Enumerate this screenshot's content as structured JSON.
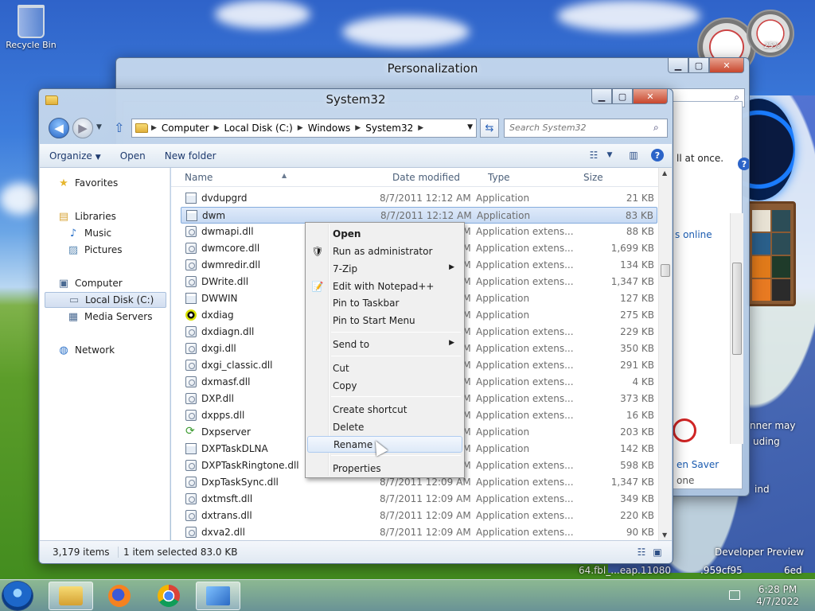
{
  "desktop": {
    "recycle_bin_label": "Recycle Bin",
    "bg_fragments": [
      "nner may",
      "uding",
      "en Saver",
      "one",
      "ind",
      "Developer Preview",
      "64.fbl_...eap.11080",
      ".959cf95",
      "6ed"
    ],
    "gadget_cpu_label": "25%"
  },
  "personalization": {
    "title": "Personalization",
    "text_all_at_once": "ll at once.",
    "text_online": "s online",
    "screen_saver_label": "en Saver",
    "screen_saver_value": "one"
  },
  "explorer": {
    "title": "System32",
    "breadcrumbs": [
      "Computer",
      "Local Disk (C:)",
      "Windows",
      "System32"
    ],
    "search_placeholder": "Search System32",
    "commands": {
      "organize": "Organize",
      "open": "Open",
      "new_folder": "New folder"
    },
    "nav": {
      "favorites": "Favorites",
      "libraries": "Libraries",
      "music": "Music",
      "pictures": "Pictures",
      "computer": "Computer",
      "local_disk": "Local Disk (C:)",
      "media_servers": "Media Servers",
      "network": "Network"
    },
    "columns": {
      "name": "Name",
      "date_modified": "Date modified",
      "type": "Type",
      "size": "Size"
    },
    "files": [
      {
        "name": "dvdupgrd",
        "date": "8/7/2011 12:12 AM",
        "type": "Application",
        "size": "21 KB",
        "icon": "app"
      },
      {
        "name": "dwm",
        "date": "8/7/2011 12:12 AM",
        "type": "Application",
        "size": "83 KB",
        "icon": "app"
      },
      {
        "name": "dwmapi.dll",
        "date": "8/7/2011 12:12 AM",
        "type": "Application extens...",
        "size": "88 KB",
        "icon": "dll"
      },
      {
        "name": "dwmcore.dll",
        "date": "8/7/2011 12:12 AM",
        "type": "Application extens...",
        "size": "1,699 KB",
        "icon": "dll"
      },
      {
        "name": "dwmredir.dll",
        "date": "8/7/2011 12:12 AM",
        "type": "Application extens...",
        "size": "134 KB",
        "icon": "dll"
      },
      {
        "name": "DWrite.dll",
        "date": "8/7/2011 12:12 AM",
        "type": "Application extens...",
        "size": "1,347 KB",
        "icon": "dll"
      },
      {
        "name": "DWWIN",
        "date": "8/7/2011 12:12 AM",
        "type": "Application",
        "size": "127 KB",
        "icon": "app"
      },
      {
        "name": "dxdiag",
        "date": "8/7/2011 12:12 AM",
        "type": "Application",
        "size": "275 KB",
        "icon": "xbox"
      },
      {
        "name": "dxdiagn.dll",
        "date": "8/7/2011 12:12 AM",
        "type": "Application extens...",
        "size": "229 KB",
        "icon": "dll"
      },
      {
        "name": "dxgi.dll",
        "date": "8/7/2011 12:12 AM",
        "type": "Application extens...",
        "size": "350 KB",
        "icon": "dll"
      },
      {
        "name": "dxgi_classic.dll",
        "date": "8/7/2011 12:12 AM",
        "type": "Application extens...",
        "size": "291 KB",
        "icon": "dll"
      },
      {
        "name": "dxmasf.dll",
        "date": "8/7/2011 12:12 AM",
        "type": "Application extens...",
        "size": "4 KB",
        "icon": "dll"
      },
      {
        "name": "DXP.dll",
        "date": "8/7/2011 12:12 AM",
        "type": "Application extens...",
        "size": "373 KB",
        "icon": "dll"
      },
      {
        "name": "dxpps.dll",
        "date": "8/7/2011 12:12 AM",
        "type": "Application extens...",
        "size": "16 KB",
        "icon": "dll"
      },
      {
        "name": "Dxpserver",
        "date": "8/7/2011 12:12 AM",
        "type": "Application",
        "size": "203 KB",
        "icon": "green"
      },
      {
        "name": "DXPTaskDLNA",
        "date": "8/7/2011 12:12 AM",
        "type": "Application",
        "size": "142 KB",
        "icon": "app"
      },
      {
        "name": "DXPTaskRingtone.dll",
        "date": "8/7/2011 12:12 AM",
        "type": "Application extens...",
        "size": "598 KB",
        "icon": "dll"
      },
      {
        "name": "DxpTaskSync.dll",
        "date": "8/7/2011 12:09 AM",
        "type": "Application extens...",
        "size": "1,347 KB",
        "icon": "dll"
      },
      {
        "name": "dxtmsft.dll",
        "date": "8/7/2011 12:09 AM",
        "type": "Application extens...",
        "size": "349 KB",
        "icon": "dll"
      },
      {
        "name": "dxtrans.dll",
        "date": "8/7/2011 12:09 AM",
        "type": "Application extens...",
        "size": "220 KB",
        "icon": "dll"
      },
      {
        "name": "dxva2.dll",
        "date": "8/7/2011 12:09 AM",
        "type": "Application extens...",
        "size": "90 KB",
        "icon": "dll"
      }
    ],
    "selected_index": 1,
    "status": {
      "item_count": "3,179 items",
      "selection": "1 item selected  83.0 KB"
    }
  },
  "context_menu": {
    "items": [
      {
        "label": "Open",
        "bold": true
      },
      {
        "label": "Run as administrator",
        "icon": "shield-icon"
      },
      {
        "label": "7-Zip",
        "submenu": true
      },
      {
        "label": "Edit with Notepad++",
        "icon": "notepad-icon"
      },
      {
        "label": "Pin to Taskbar"
      },
      {
        "label": "Pin to Start Menu"
      },
      {
        "label": "Send to",
        "submenu": true
      },
      {
        "label": "Cut"
      },
      {
        "label": "Copy"
      },
      {
        "label": "Create shortcut"
      },
      {
        "label": "Delete"
      },
      {
        "label": "Rename",
        "hover": true
      },
      {
        "label": "Properties"
      }
    ]
  },
  "taskbar": {
    "time": "6:28 PM",
    "date": "4/7/2022"
  }
}
